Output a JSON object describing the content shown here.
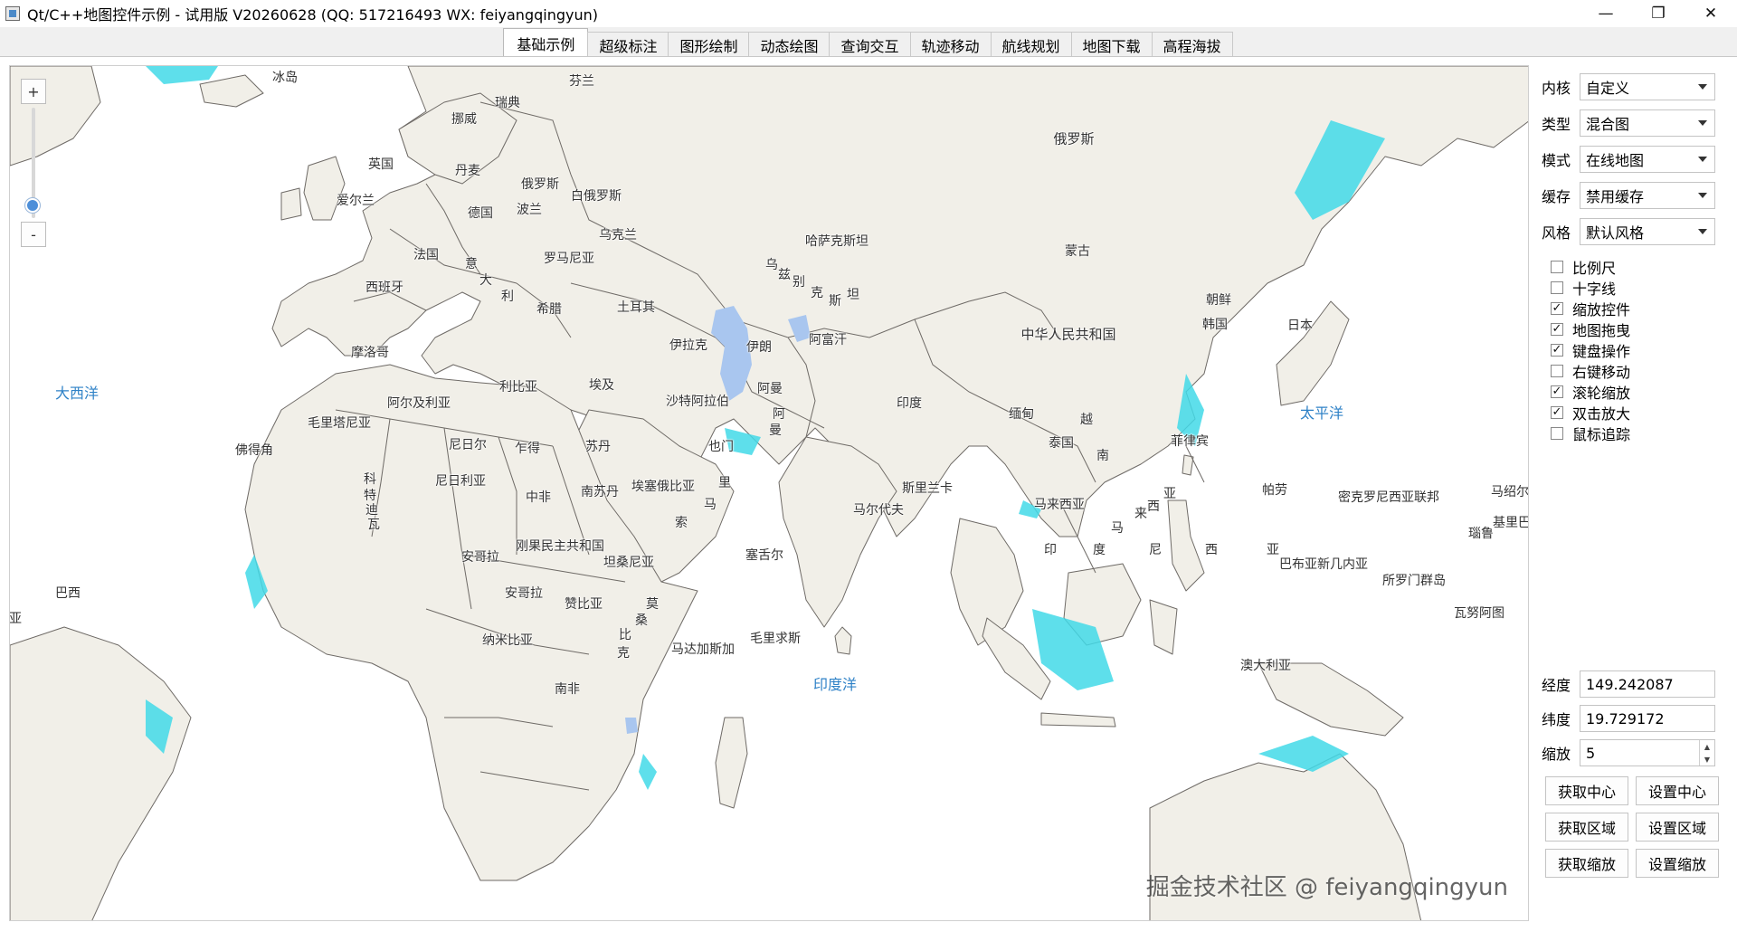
{
  "window": {
    "title": "Qt/C++地图控件示例 - 试用版 V20260628 (QQ: 517216493 WX: feiyangqingyun)",
    "minimize": "—",
    "maximize": "❐",
    "close": "✕"
  },
  "tabs": [
    "基础示例",
    "超级标注",
    "图形绘制",
    "动态绘图",
    "查询交互",
    "轨迹移动",
    "航线规划",
    "地图下载",
    "高程海拔"
  ],
  "active_tab": "基础示例",
  "map": {
    "zoom_in": "+",
    "zoom_out": "-",
    "oceans": [
      "大西洋",
      "太平洋",
      "印度洋"
    ],
    "labels": {
      "russia": "俄罗斯",
      "kazakhstan": "哈萨克斯坦",
      "mongolia": "蒙古",
      "china": "中华人民共和国",
      "iceland": "冰岛",
      "finland": "芬兰",
      "sweden": "瑞典",
      "norway": "挪威",
      "uk": "英国",
      "ireland": "爱尔兰",
      "denmark": "丹麦",
      "russia_w": "俄罗斯",
      "belarus": "白俄罗斯",
      "germany": "德国",
      "poland": "波兰",
      "ukraine": "乌克兰",
      "france": "法国",
      "romania": "罗马尼亚",
      "spain": "西班牙",
      "turkey": "土耳其",
      "greece": "希腊",
      "italy_1": "意",
      "italy_2": "大",
      "italy_3": "利",
      "uzb_1": "乌",
      "uzb_2": "兹",
      "uzb_3": "别",
      "uzb_4": "克",
      "uzb_5": "斯",
      "uzb_6": "坦",
      "iran": "伊朗",
      "iraq": "伊拉克",
      "afghanistan": "阿富汗",
      "north_korea": "朝鲜",
      "south_korea": "韩国",
      "japan": "日本",
      "morocco": "摩洛哥",
      "algeria": "阿尔及利亚",
      "libya": "利比亚",
      "egypt": "埃及",
      "saudi": "沙特阿拉伯",
      "oman_1": "阿曼",
      "oman_2": "阿",
      "oman_3": "曼",
      "india": "印度",
      "myanmar": "缅甸",
      "thailand": "泰国",
      "vietnam_1": "越",
      "vietnam_2": "南",
      "philippines": "菲律宾",
      "mauritania": "毛里塔尼亚",
      "cape_verde": "佛得角",
      "niger": "尼日尔",
      "chad": "乍得",
      "sudan": "苏丹",
      "yemen": "也门",
      "mali_1": "科",
      "mali_2": "特",
      "mali_3": "迪",
      "mali_4": "瓦",
      "nigeria": "尼日利亚",
      "car": "中非",
      "south_sudan": "南苏丹",
      "ethiopia": "埃塞俄比亚",
      "somalia_1": "里",
      "somalia_2": "马",
      "somalia_3": "索",
      "sri_lanka": "斯里兰卡",
      "maldives": "马尔代夫",
      "malaysia": "马来西亚",
      "malaysia_2": "马",
      "malaysia_3": "来",
      "malaysia_4": "西",
      "malaysia_5": "亚",
      "palau": "帕劳",
      "micronesia": "密克罗尼西亚联邦",
      "marshall": "马绍尔",
      "kiribati": "基里巴",
      "nauru": "瑙鲁",
      "indonesia_1": "印",
      "indonesia_2": "度",
      "indonesia_3": "尼",
      "indonesia_4": "西",
      "indonesia_5": "亚",
      "angola": "安哥拉",
      "drc": "刚果民主共和国",
      "tanzania": "坦桑尼亚",
      "seychelles": "塞舌尔",
      "angola_2": "安哥拉",
      "zambia": "赞比亚",
      "mozambique_1": "莫",
      "mozambique_2": "桑",
      "mozambique_3": "比",
      "mozambique_4": "克",
      "namibia": "纳米比亚",
      "madagascar": "马达加斯加",
      "mauritius": "毛里求斯",
      "south_africa": "南非",
      "brazil": "巴西",
      "brazil_2": "亚",
      "png": "巴布亚新几内亚",
      "solomon": "所罗门群岛",
      "vanuatu": "瓦努阿图",
      "australia": "澳大利亚"
    }
  },
  "panel": {
    "core": {
      "label": "内核",
      "value": "自定义"
    },
    "type": {
      "label": "类型",
      "value": "混合图"
    },
    "mode": {
      "label": "模式",
      "value": "在线地图"
    },
    "cache": {
      "label": "缓存",
      "value": "禁用缓存"
    },
    "style": {
      "label": "风格",
      "value": "默认风格"
    },
    "checks": [
      {
        "label": "比例尺",
        "checked": false
      },
      {
        "label": "十字线",
        "checked": false
      },
      {
        "label": "缩放控件",
        "checked": true
      },
      {
        "label": "地图拖曳",
        "checked": true
      },
      {
        "label": "键盘操作",
        "checked": true
      },
      {
        "label": "右键移动",
        "checked": false
      },
      {
        "label": "滚轮缩放",
        "checked": true
      },
      {
        "label": "双击放大",
        "checked": true
      },
      {
        "label": "鼠标追踪",
        "checked": false
      }
    ],
    "lng": {
      "label": "经度",
      "value": "149.242087"
    },
    "lat": {
      "label": "纬度",
      "value": "19.729172"
    },
    "zoom": {
      "label": "缩放",
      "value": "5"
    },
    "buttons": {
      "get_center": "获取中心",
      "set_center": "设置中心",
      "get_area": "获取区域",
      "set_area": "设置区域",
      "get_zoom": "获取缩放",
      "set_zoom": "设置缩放"
    }
  },
  "watermark": "掘金技术社区 @ feiyangqingyun",
  "colors": {
    "land": "#f1efe8",
    "border": "#6e6a66",
    "coast": "#42d9e8",
    "water": "#ffffff",
    "lake": "#a9c6ef",
    "ocean_label": "#2f82c7"
  }
}
